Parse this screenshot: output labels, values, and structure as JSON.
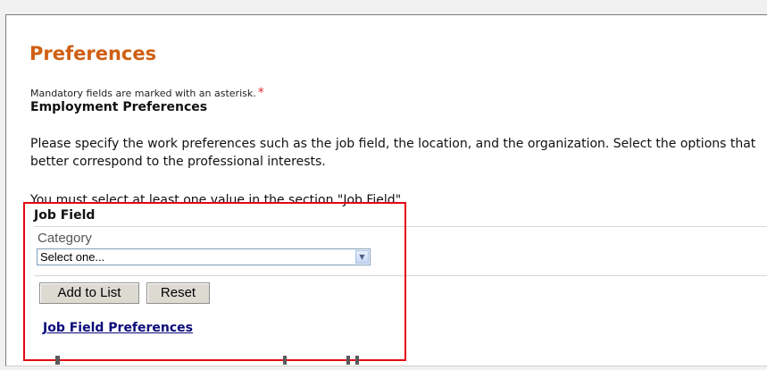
{
  "page": {
    "title": "Preferences",
    "mandatory_note": "Mandatory fields are marked with an asterisk.",
    "asterisk": "*",
    "asterisk_color": "#e0292d"
  },
  "employment": {
    "heading": "Employment Preferences",
    "description": "Please specify the work preferences such as the job field, the location, and the organization. Select the options that better correspond to the professional interests.",
    "requirement": "You must select at least one value in the section \"Job Field\"."
  },
  "job_field": {
    "heading": "Job Field",
    "category_label": "Category",
    "category_value": "Select one...",
    "add_button": "Add to List",
    "reset_button": "Reset",
    "preferences_link": "Job Field Preferences"
  },
  "colors": {
    "title": "#cf5f12",
    "highlight_box": "#e30613",
    "link": "#0a0a7a"
  }
}
